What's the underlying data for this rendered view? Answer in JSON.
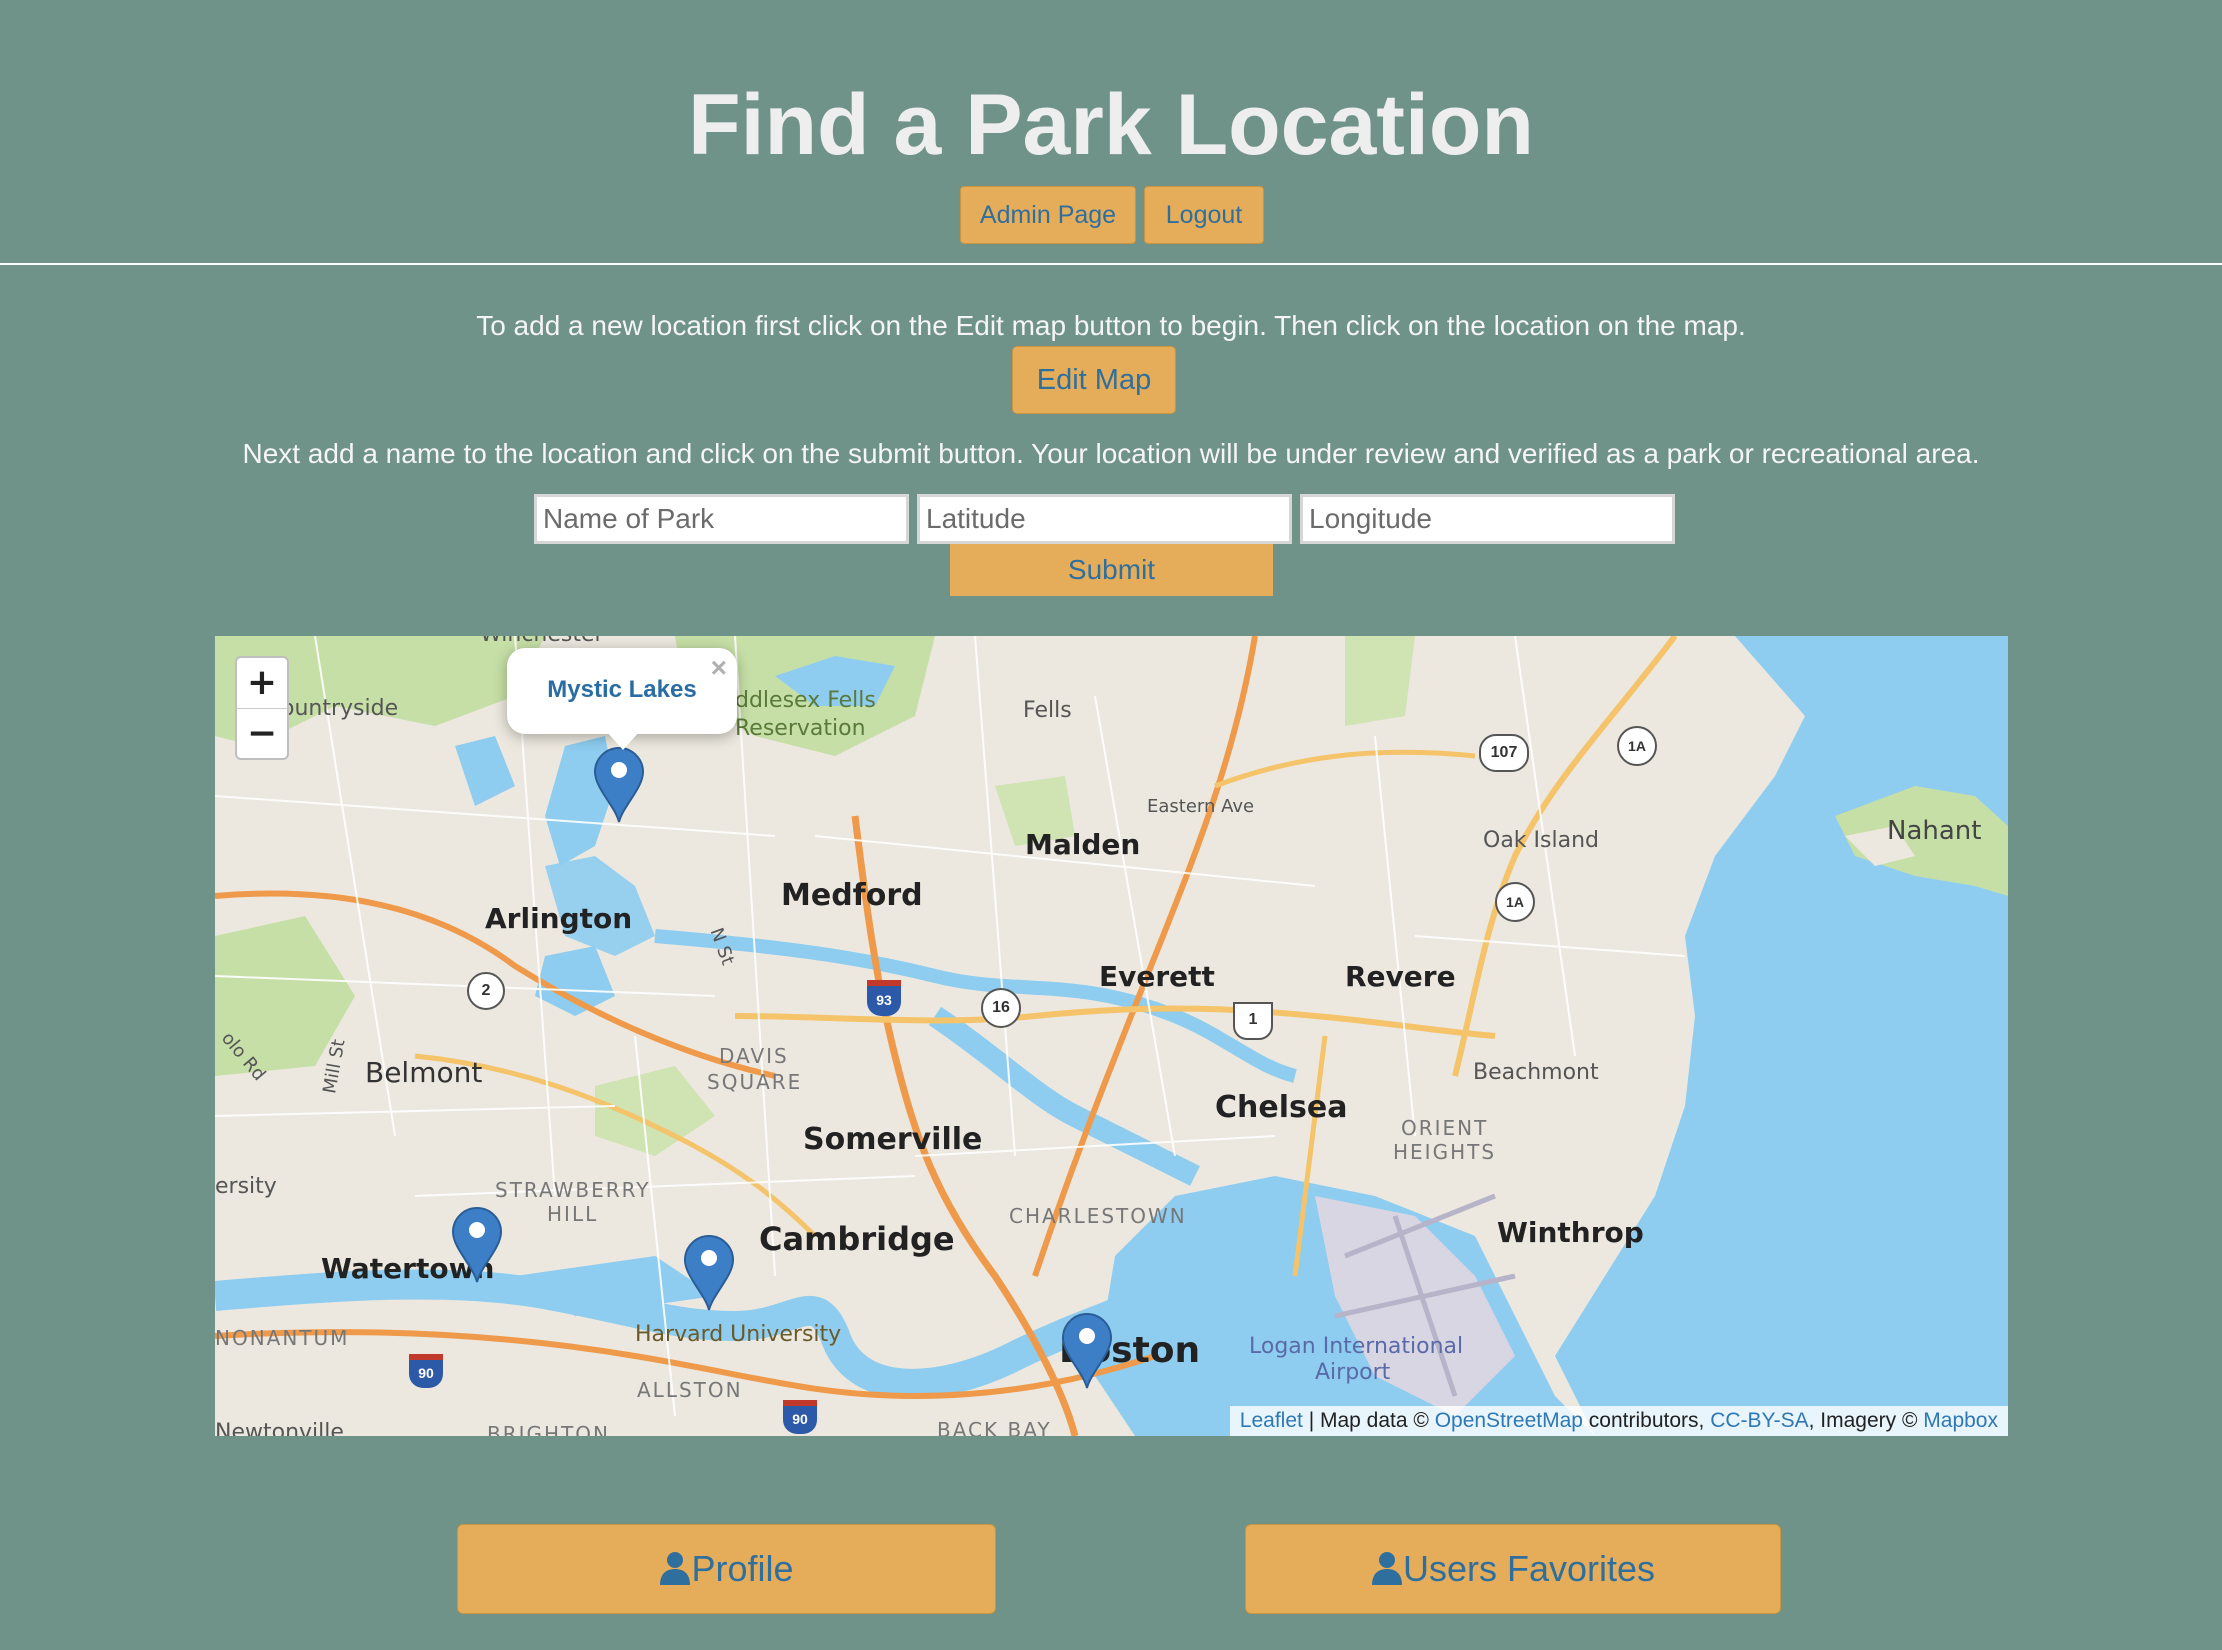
{
  "page": {
    "title": "Find a Park Location"
  },
  "header": {
    "admin_label": "Admin Page",
    "logout_label": "Logout"
  },
  "instructions": {
    "step1": "To add a new location first click on the Edit map button to begin. Then click on the location on the map.",
    "step2": "Next add a name to the location and click on the submit button. Your location will be under review and verified as a park or recreational area."
  },
  "edit_map_label": "Edit Map",
  "form": {
    "name_placeholder": "Name of Park",
    "lat_placeholder": "Latitude",
    "lng_placeholder": "Longitude",
    "submit_label": "Submit"
  },
  "map": {
    "zoom_in": "+",
    "zoom_out": "−",
    "popup": {
      "text": "Mystic Lakes",
      "close": "×"
    },
    "labels": {
      "winchester": "Winchester",
      "countryside": "ountryside",
      "middlesex": "ddlesex Fells",
      "reservation": "Reservation",
      "fells": "Fells",
      "eastern_ave": "Eastern Ave",
      "malden": "Malden",
      "oak_island": "Oak Island",
      "nahant": "Nahant",
      "medford": "Medford",
      "arlington": "Arlington",
      "n_st": "N St",
      "everett": "Everett",
      "revere": "Revere",
      "davis": "DAVIS",
      "square": "SQUARE",
      "belmont": "Belmont",
      "mill_st": "Mill St",
      "olo_rd": "olo Rd",
      "chelsea": "Chelsea",
      "beachmont": "Beachmont",
      "orient": "ORIENT",
      "heights": "HEIGHTS",
      "somerville": "Somerville",
      "ersity": "ersity",
      "strawberry": "STRAWBERRY",
      "hill": "HILL",
      "charlestown": "CHARLESTOWN",
      "winthrop": "Winthrop",
      "watertown": "Watertown",
      "cambridge": "Cambridge",
      "nonantum": "NONANTUM",
      "harvard": "Harvard University",
      "logan": "Logan International",
      "airport": "Airport",
      "boston": "Boston",
      "allston": "ALLSTON",
      "brighton": "BRIGHTON",
      "back_bay": "BACK BAY",
      "newtonville": "Newtonville"
    },
    "shields": {
      "r107": "107",
      "r1a_a": "1A",
      "r1a_b": "1A",
      "r2": "2",
      "r93": "93",
      "r16": "16",
      "r1": "1",
      "r90_a": "90",
      "r90_b": "90"
    },
    "attribution": {
      "leaflet": "Leaflet",
      "sep": " | Map data © ",
      "osm": "OpenStreetMap",
      "contrib": " contributors, ",
      "ccbysa": "CC-BY-SA",
      "imagery": ", Imagery © ",
      "mapbox": "Mapbox"
    },
    "colors": {
      "water": "#8ecdf0",
      "land": "#ece8df",
      "park": "#c6dfa6",
      "road": "#f4c36a",
      "highway": "#ee9a4a",
      "marker": "#3d7fc7"
    }
  },
  "footer": {
    "profile_label": "Profile",
    "favorites_label": "Users Favorites"
  }
}
